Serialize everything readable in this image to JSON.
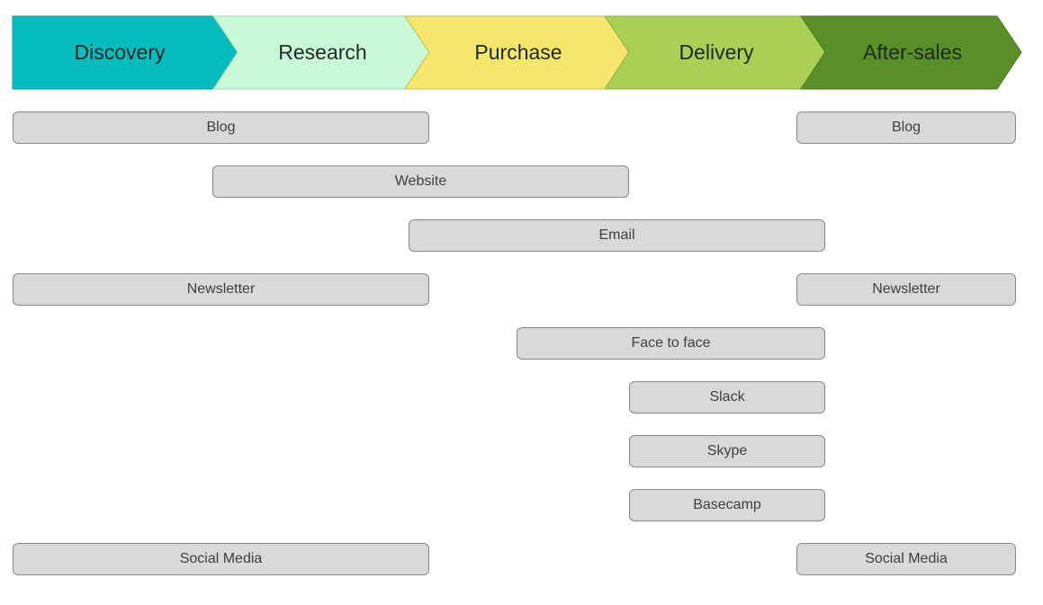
{
  "stages": [
    {
      "label": "Discovery",
      "color": "#05bcbd",
      "stroke": "#0a9e9e"
    },
    {
      "label": "Research",
      "color": "#c8fad7",
      "stroke": "#9fd8b5"
    },
    {
      "label": "Purchase",
      "color": "#f6e66b",
      "stroke": "#c9bb52"
    },
    {
      "label": "Delivery",
      "color": "#a9cf55",
      "stroke": "#8fb042"
    },
    {
      "label": "After-sales",
      "color": "#588f27",
      "stroke": "#4a7b20"
    }
  ],
  "channels": [
    {
      "label": "Blog",
      "row": 0,
      "from": 0,
      "to": 1
    },
    {
      "label": "Blog",
      "row": 0,
      "from": 4,
      "to": 4
    },
    {
      "label": "Website",
      "row": 1,
      "from": 1,
      "to": 2
    },
    {
      "label": "Email",
      "row": 2,
      "from": 2,
      "to": 3
    },
    {
      "label": "Newsletter",
      "row": 3,
      "from": 0,
      "to": 1
    },
    {
      "label": "Newsletter",
      "row": 3,
      "from": 4,
      "to": 4
    },
    {
      "label": "Face to face",
      "row": 4,
      "from": 2.55,
      "to": 3
    },
    {
      "label": "Slack",
      "row": 5,
      "from": 3,
      "to": 3
    },
    {
      "label": "Skype",
      "row": 6,
      "from": 3,
      "to": 3
    },
    {
      "label": "Basecamp",
      "row": 7,
      "from": 3,
      "to": 3
    },
    {
      "label": "Social Media",
      "row": 8,
      "from": 0,
      "to": 1
    },
    {
      "label": "Social Media",
      "row": 8,
      "from": 4,
      "to": 4
    }
  ]
}
